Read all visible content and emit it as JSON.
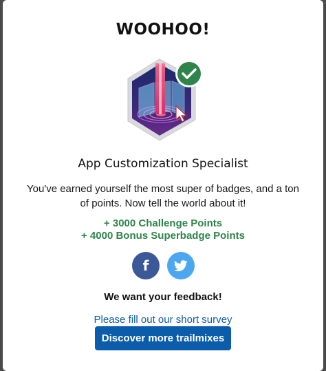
{
  "modal": {
    "title": "WOOHOO!",
    "badge_name": "App Customization Specialist",
    "message": "You've earned yourself the most super of badges, and a ton of points. Now tell the world about it!",
    "challenge_points": "+ 3000 Challenge Points",
    "bonus_points": "+ 4000 Bonus Superbadge Points",
    "feedback_heading": "We want your feedback!",
    "survey_link": "Please fill out our short survey",
    "cta_button": "Discover more trailmixes"
  },
  "social": {
    "facebook_icon": "facebook-icon",
    "facebook_glyph": "f",
    "twitter_icon": "twitter-icon"
  },
  "colors": {
    "points_green": "#2e844a",
    "link_blue": "#0b5cab",
    "facebook_blue": "#3b5998",
    "twitter_blue": "#4da7f0",
    "check_green": "#2e844a"
  }
}
